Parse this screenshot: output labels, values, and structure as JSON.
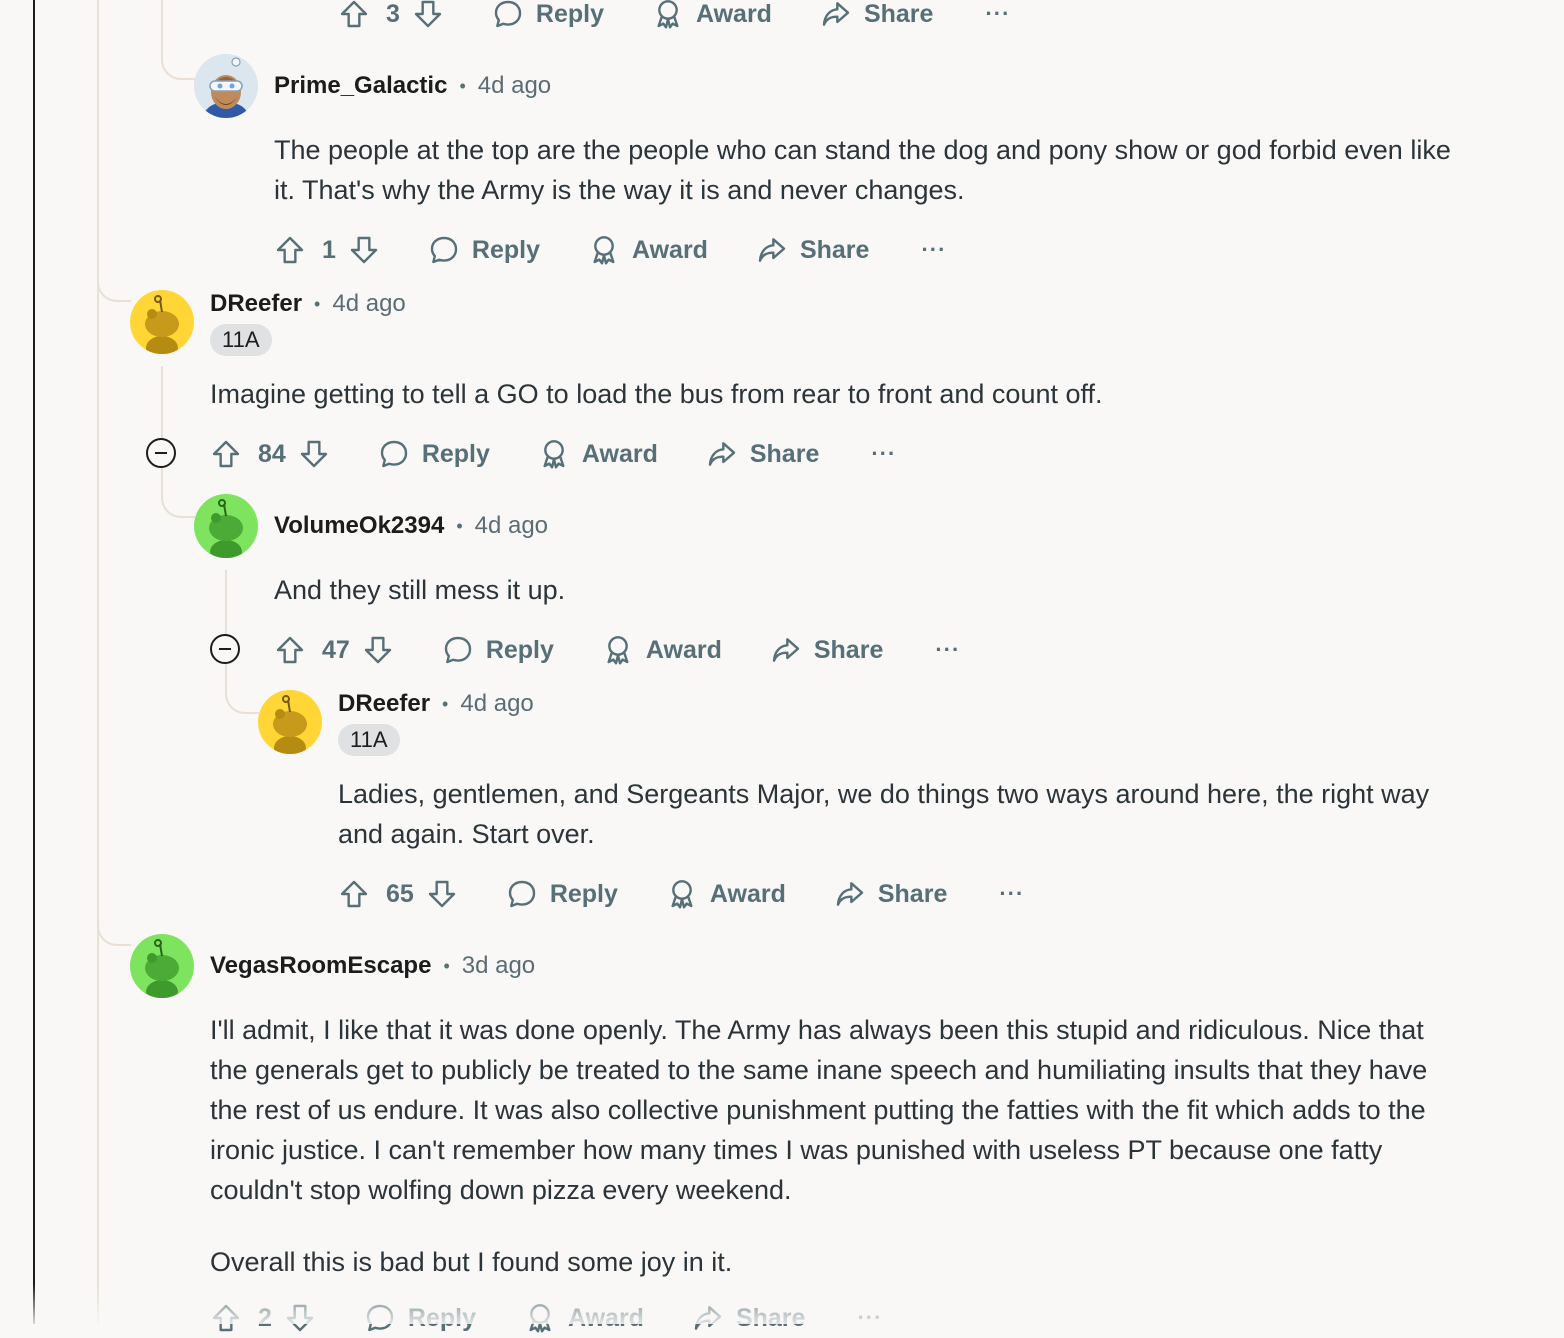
{
  "comments": [
    {
      "actions": {
        "votes": "3",
        "reply": "Reply",
        "award": "Award",
        "share": "Share",
        "more": "···"
      }
    },
    {
      "username": "Prime_Galactic",
      "time": "4d ago",
      "avatar": "astronaut-avatar",
      "text": [
        "The people at the top are the people who can stand the dog and pony show or god forbid even like it. That's why the Army is the way it is and never changes."
      ],
      "actions": {
        "votes": "1",
        "reply": "Reply",
        "award": "Award",
        "share": "Share",
        "more": "···"
      }
    },
    {
      "username": "DReefer",
      "time": "4d ago",
      "flair": "11A",
      "avatar": "snoo-yellow-avatar",
      "text": [
        "Imagine getting to tell a GO to load the bus from rear to front and count off."
      ],
      "actions": {
        "votes": "84",
        "reply": "Reply",
        "award": "Award",
        "share": "Share",
        "more": "···"
      }
    },
    {
      "username": "VolumeOk2394",
      "time": "4d ago",
      "avatar": "snoo-green-avatar",
      "text": [
        "And they still mess it up."
      ],
      "actions": {
        "votes": "47",
        "reply": "Reply",
        "award": "Award",
        "share": "Share",
        "more": "···"
      }
    },
    {
      "username": "DReefer",
      "time": "4d ago",
      "flair": "11A",
      "avatar": "snoo-yellow-avatar",
      "text": [
        "Ladies, gentlemen, and Sergeants Major, we do things two ways around here, the right way and again. Start over."
      ],
      "actions": {
        "votes": "65",
        "reply": "Reply",
        "award": "Award",
        "share": "Share",
        "more": "···"
      }
    },
    {
      "username": "VegasRoomEscape",
      "time": "3d ago",
      "avatar": "snoo-green-avatar",
      "text": [
        "I'll admit, I like that it was done openly. The Army has always been this stupid and ridiculous. Nice that the generals get to publicly be treated to the same inane speech and humiliating insults that they have the rest of us endure. It was also collective punishment putting the fatties with the fit which adds to the ironic justice. I can't remember how many times I was punished with useless PT because one fatty couldn't stop wolfing down pizza every weekend.",
        "Overall this is bad but I found some joy in it."
      ],
      "actions": {
        "votes": "2",
        "reply": "Reply",
        "award": "Award",
        "share": "Share",
        "more": "···"
      }
    }
  ],
  "colors": {
    "background": "#f9f8f7",
    "thread_line": "#e9dfd2",
    "muted_text": "#576f76",
    "flair_bg": "#dfe1e3",
    "avatar_yellow": "#ffd635",
    "avatar_green": "#7ee35f"
  },
  "icons": [
    "upvote-icon",
    "downvote-icon",
    "comment-icon",
    "award-icon",
    "share-icon",
    "more-icon",
    "collapse-icon"
  ]
}
